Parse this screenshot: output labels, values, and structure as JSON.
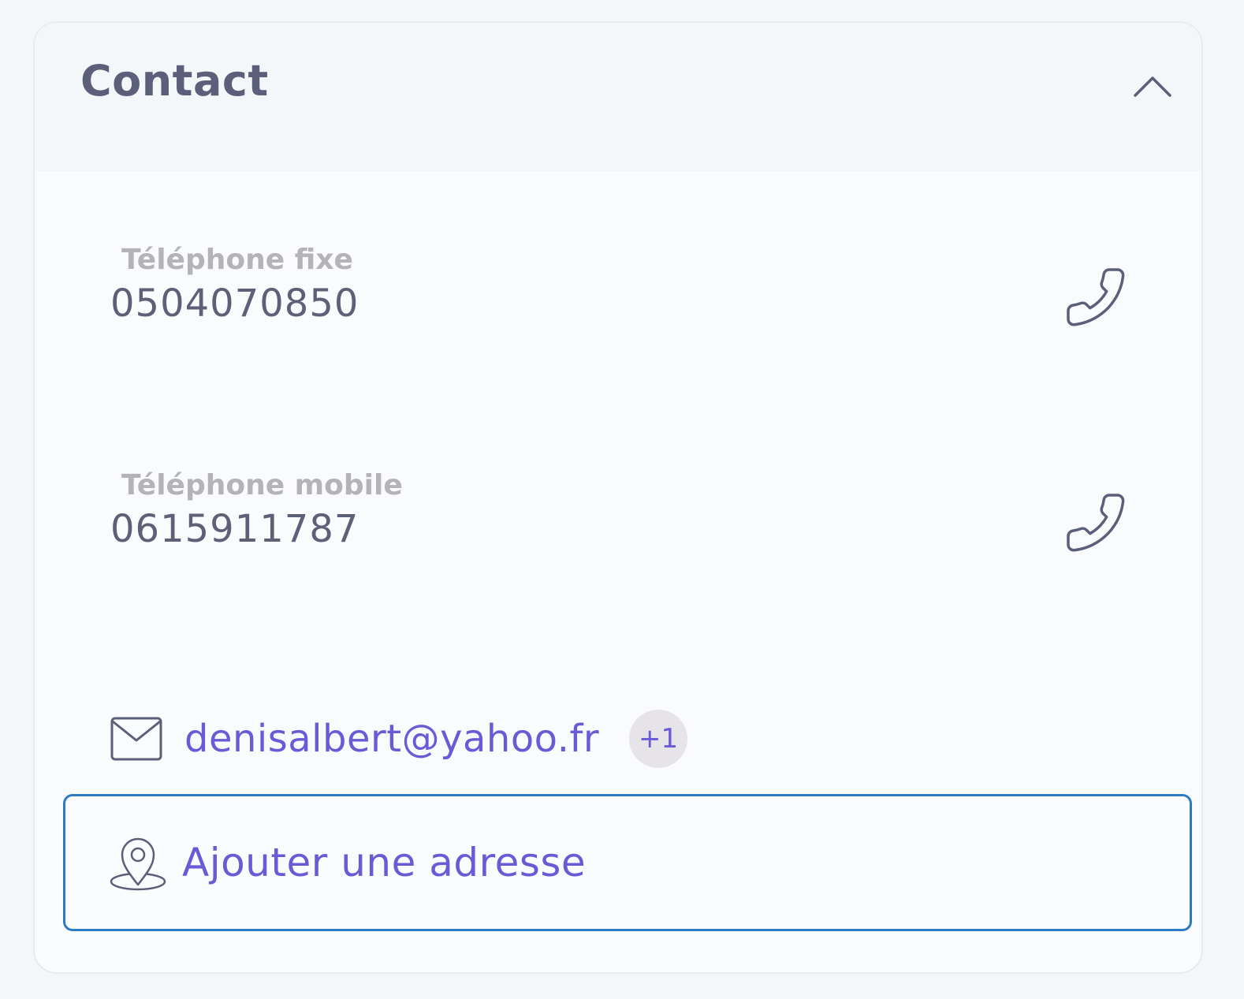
{
  "contact": {
    "title": "Contact",
    "collapse_icon": "chevron-up-icon",
    "landline": {
      "label": "Téléphone fixe",
      "value": "0504070850",
      "icon": "phone-icon"
    },
    "mobile": {
      "label": "Téléphone mobile",
      "value": "0615911787",
      "icon": "phone-icon"
    },
    "email": {
      "value": "denisalbert@yahoo.fr",
      "extra_count": "+1",
      "icon": "envelope-icon"
    },
    "address": {
      "label": "Ajouter une adresse",
      "icon": "map-pin-icon"
    }
  },
  "colors": {
    "accent": "#6b5ad6",
    "focus_border": "#2d7bc2",
    "title": "#5c5f7a",
    "label": "#b3b3b8",
    "value": "#5d6076",
    "icon_stroke": "#5c5f7a"
  }
}
